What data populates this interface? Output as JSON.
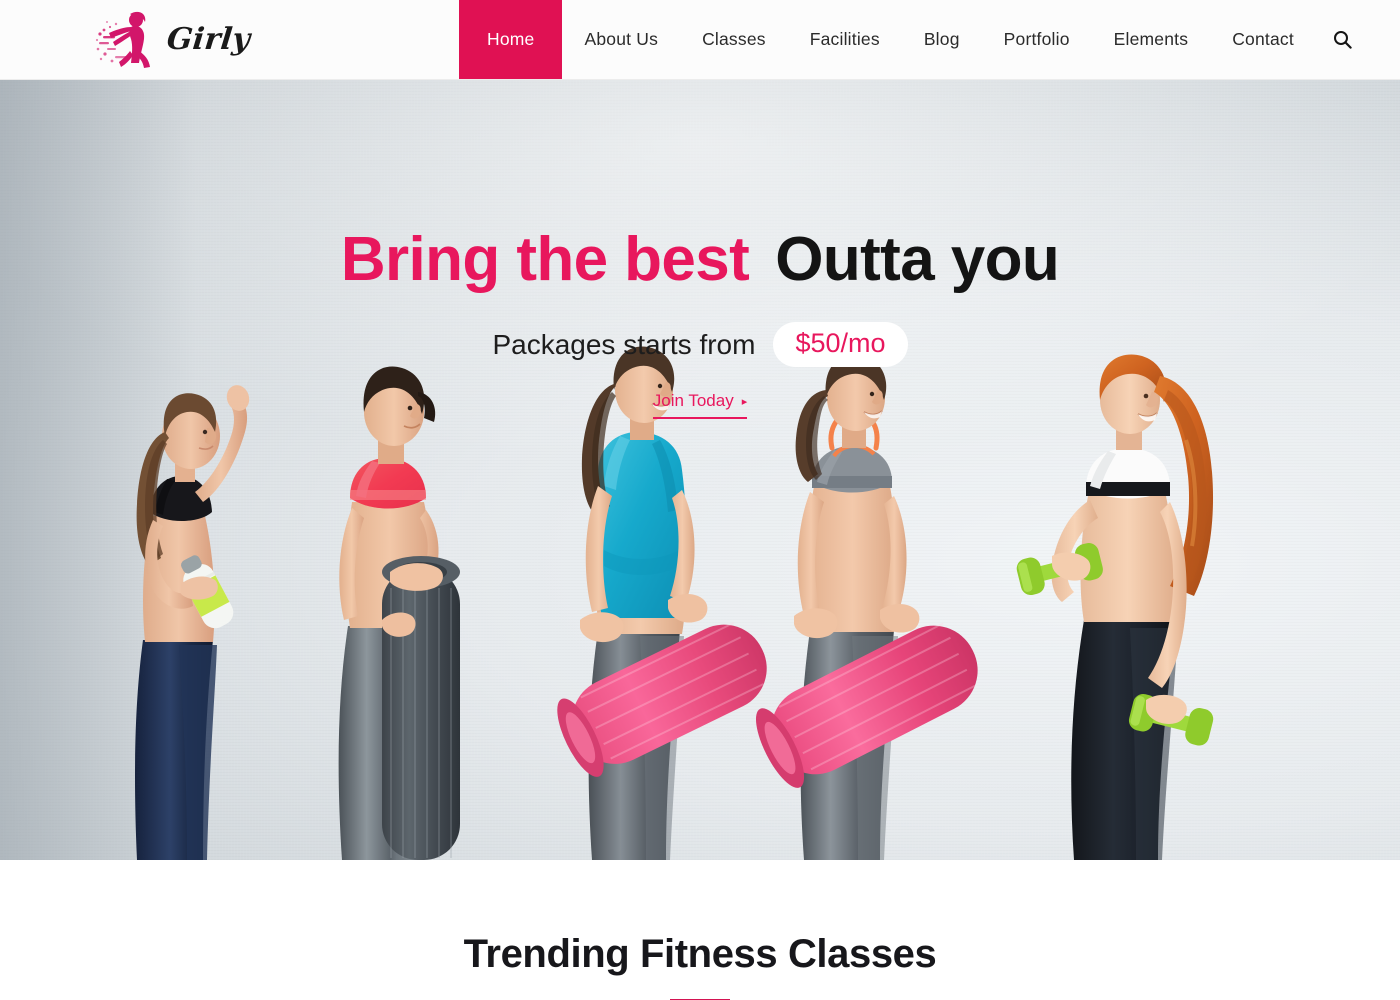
{
  "brand": {
    "name": "Girly",
    "logo_icon": "running-woman-silhouette-icon"
  },
  "nav": {
    "items": [
      {
        "label": "Home",
        "active": true
      },
      {
        "label": "About Us",
        "active": false
      },
      {
        "label": "Classes",
        "active": false
      },
      {
        "label": "Facilities",
        "active": false
      },
      {
        "label": "Blog",
        "active": false
      },
      {
        "label": "Portfolio",
        "active": false
      },
      {
        "label": "Elements",
        "active": false
      },
      {
        "label": "Contact",
        "active": false
      }
    ],
    "search_icon": "search-icon"
  },
  "hero": {
    "title_accent": "Bring the best",
    "title_dark": "Outta you",
    "subtitle": "Packages starts from",
    "price": "$50/mo",
    "cta_label": "Join Today",
    "cta_caret": "▸"
  },
  "section": {
    "title": "Trending Fitness Classes"
  },
  "colors": {
    "accent": "#e01153",
    "accent_text": "#e8175d",
    "rule": "#d41352",
    "nav_bg": "#fcfcfc",
    "dark_text": "#141414",
    "hero_bg": "#c4cbd0"
  }
}
